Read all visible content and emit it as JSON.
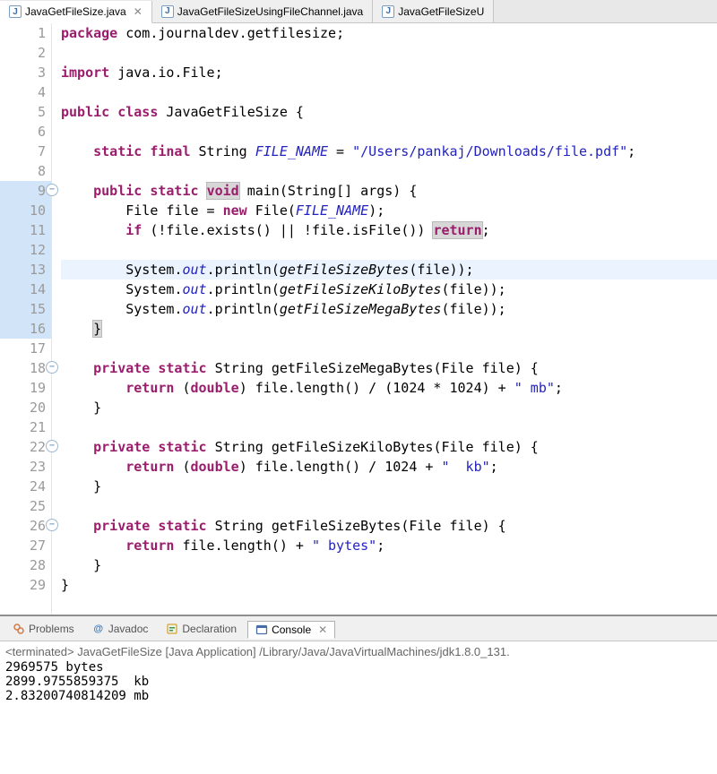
{
  "editor_tabs": [
    {
      "label": "JavaGetFileSize.java",
      "active": true,
      "closable": true
    },
    {
      "label": "JavaGetFileSizeUsingFileChannel.java",
      "active": false,
      "closable": false
    },
    {
      "label": "JavaGetFileSizeU",
      "active": false,
      "closable": false
    }
  ],
  "code": {
    "package_kw": "package",
    "package_name": "com.journaldev.getfilesize",
    "import_kw": "import",
    "import_name": "java.io.File",
    "public_kw": "public",
    "class_kw": "class",
    "class_name": "JavaGetFileSize",
    "static_kw": "static",
    "final_kw": "final",
    "string_type": "String",
    "file_name_field": "FILE_NAME",
    "file_name_value": "\"/Users/pankaj/Downloads/file.pdf\"",
    "void_kw": "void",
    "main_name": "main",
    "args_type": "String",
    "args_name": "args",
    "file_type": "File",
    "file_var": "file",
    "new_kw": "new",
    "if_kw": "if",
    "exists_call": "exists",
    "isfile_call": "isFile",
    "return_kw": "return",
    "system_out": "System",
    "out_field": "out",
    "println": "println",
    "get_bytes": "getFileSizeBytes",
    "get_kb": "getFileSizeKiloBytes",
    "get_mb": "getFileSizeMegaBytes",
    "private_kw": "private",
    "double_kw": "double",
    "length_call": "length",
    "mb_lit": "\" mb\"",
    "kb_lit": "\"  kb\"",
    "bytes_lit": "\" bytes\"",
    "mb_divisor": "(1024 * 1024)",
    "kb_divisor": "1024"
  },
  "line_numbers": [
    "1",
    "2",
    "3",
    "4",
    "5",
    "6",
    "7",
    "8",
    "9",
    "10",
    "11",
    "12",
    "13",
    "14",
    "15",
    "16",
    "17",
    "18",
    "19",
    "20",
    "21",
    "22",
    "23",
    "24",
    "25",
    "26",
    "27",
    "28",
    "29"
  ],
  "fold_lines": [
    9,
    18,
    22,
    26
  ],
  "blue_gutter": [
    9,
    10,
    11,
    12,
    13,
    14,
    15,
    16
  ],
  "highlight_line": 13,
  "views": {
    "problems": {
      "label": "Problems",
      "icon_color": "#d37a4a"
    },
    "javadoc": {
      "label": "Javadoc",
      "icon_glyph": "@",
      "icon_color": "#3b7dbf"
    },
    "declaration": {
      "label": "Declaration",
      "icon_color": "#3b9a3b"
    },
    "console": {
      "label": "Console",
      "icon_color": "#4a6da7",
      "active": true
    }
  },
  "console": {
    "header": "<terminated> JavaGetFileSize [Java Application] /Library/Java/JavaVirtualMachines/jdk1.8.0_131.",
    "lines": [
      "2969575 bytes",
      "2899.9755859375  kb",
      "2.83200740814209 mb"
    ]
  }
}
